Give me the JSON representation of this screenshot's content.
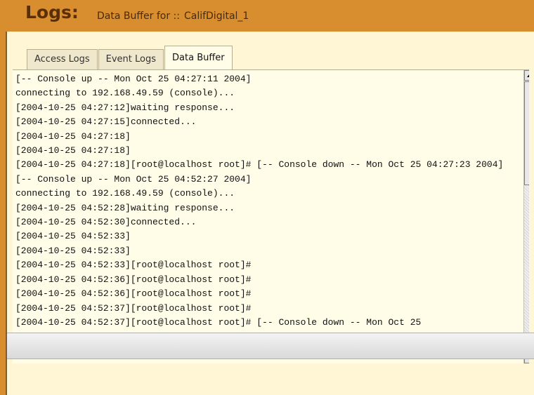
{
  "header": {
    "title": "Logs:",
    "subtitle_prefix": "Data Buffer for ::",
    "device_name": "CalifDigital_1"
  },
  "tabs": [
    {
      "label": "Access Logs",
      "active": false
    },
    {
      "label": "Event Logs",
      "active": false
    },
    {
      "label": "Data Buffer",
      "active": true
    }
  ],
  "log": {
    "lines": [
      "[-- Console up -- Mon Oct 25 04:27:11 2004]",
      "connecting to 192.168.49.59 (console)...",
      "[2004-10-25 04:27:12]waiting response...",
      "[2004-10-25 04:27:15]connected...",
      "[2004-10-25 04:27:18]",
      "[2004-10-25 04:27:18]",
      "[2004-10-25 04:27:18][root@localhost root]# [-- Console down -- Mon Oct 25 04:27:23 2004]",
      "[-- Console up -- Mon Oct 25 04:52:27 2004]",
      "connecting to 192.168.49.59 (console)...",
      "[2004-10-25 04:52:28]waiting response...",
      "[2004-10-25 04:52:30]connected...",
      "[2004-10-25 04:52:33]",
      "[2004-10-25 04:52:33]",
      "[2004-10-25 04:52:33][root@localhost root]#",
      "[2004-10-25 04:52:36][root@localhost root]#",
      "[2004-10-25 04:52:36][root@localhost root]#",
      "[2004-10-25 04:52:37][root@localhost root]#",
      "[2004-10-25 04:52:37][root@localhost root]# [-- Console down -- Mon Oct 25"
    ]
  },
  "colors": {
    "header_bg": "#d88e2f",
    "panel_bg": "#fff6d6",
    "log_bg": "#fffce8",
    "title_color": "#5a2e06"
  },
  "icons": {
    "scroll_up": "up-arrow-icon",
    "scroll_down": "down-arrow-icon"
  }
}
